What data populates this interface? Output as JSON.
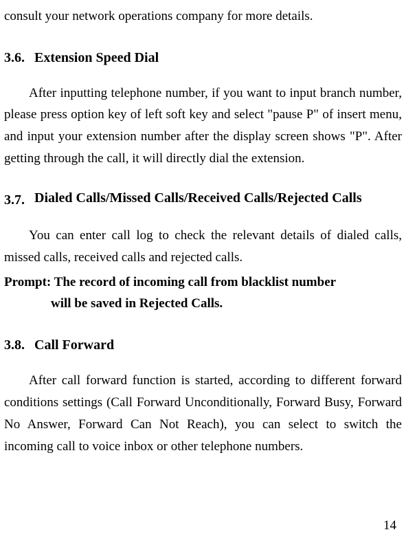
{
  "intro": "consult your network operations company for more details.",
  "sections": [
    {
      "number": "3.6.",
      "title": "Extension Speed Dial",
      "body": "After inputting telephone number, if you want to input branch number, please press option key of left soft key and select \"pause P\" of insert menu, and input your extension number after the display screen shows \"P\". After getting through the call, it will directly dial the extension."
    },
    {
      "number": "3.7.",
      "title": "Dialed Calls/Missed Calls/Received Calls/Rejected Calls",
      "body": "You can enter call log to check the relevant details of dialed calls, missed calls, received calls and rejected calls.",
      "prompt_line1": "Prompt: The record of incoming call from blacklist number",
      "prompt_line2": "will be saved in Rejected Calls."
    },
    {
      "number": "3.8.",
      "title": "Call Forward",
      "body": "After call forward function is started, according to different forward conditions settings (Call Forward Unconditionally, Forward Busy, Forward No Answer, Forward Can Not Reach), you can select to switch the incoming call to voice inbox or other telephone numbers."
    }
  ],
  "page_number": "14"
}
